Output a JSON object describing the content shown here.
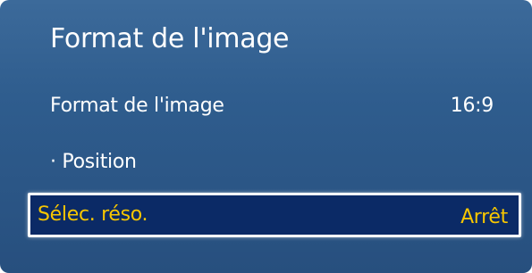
{
  "menu": {
    "title": "Format de l'image",
    "items": [
      {
        "label": "Format de l'image",
        "value": "16:9"
      },
      {
        "label": "· Position"
      },
      {
        "label": "Sélec. réso.",
        "value": "Arrêt",
        "selected": true
      }
    ]
  },
  "colors": {
    "panel_background": "#2f5d8e",
    "highlight_background": "#0b2a66",
    "highlight_text": "#f7c600",
    "text": "#ffffff"
  }
}
